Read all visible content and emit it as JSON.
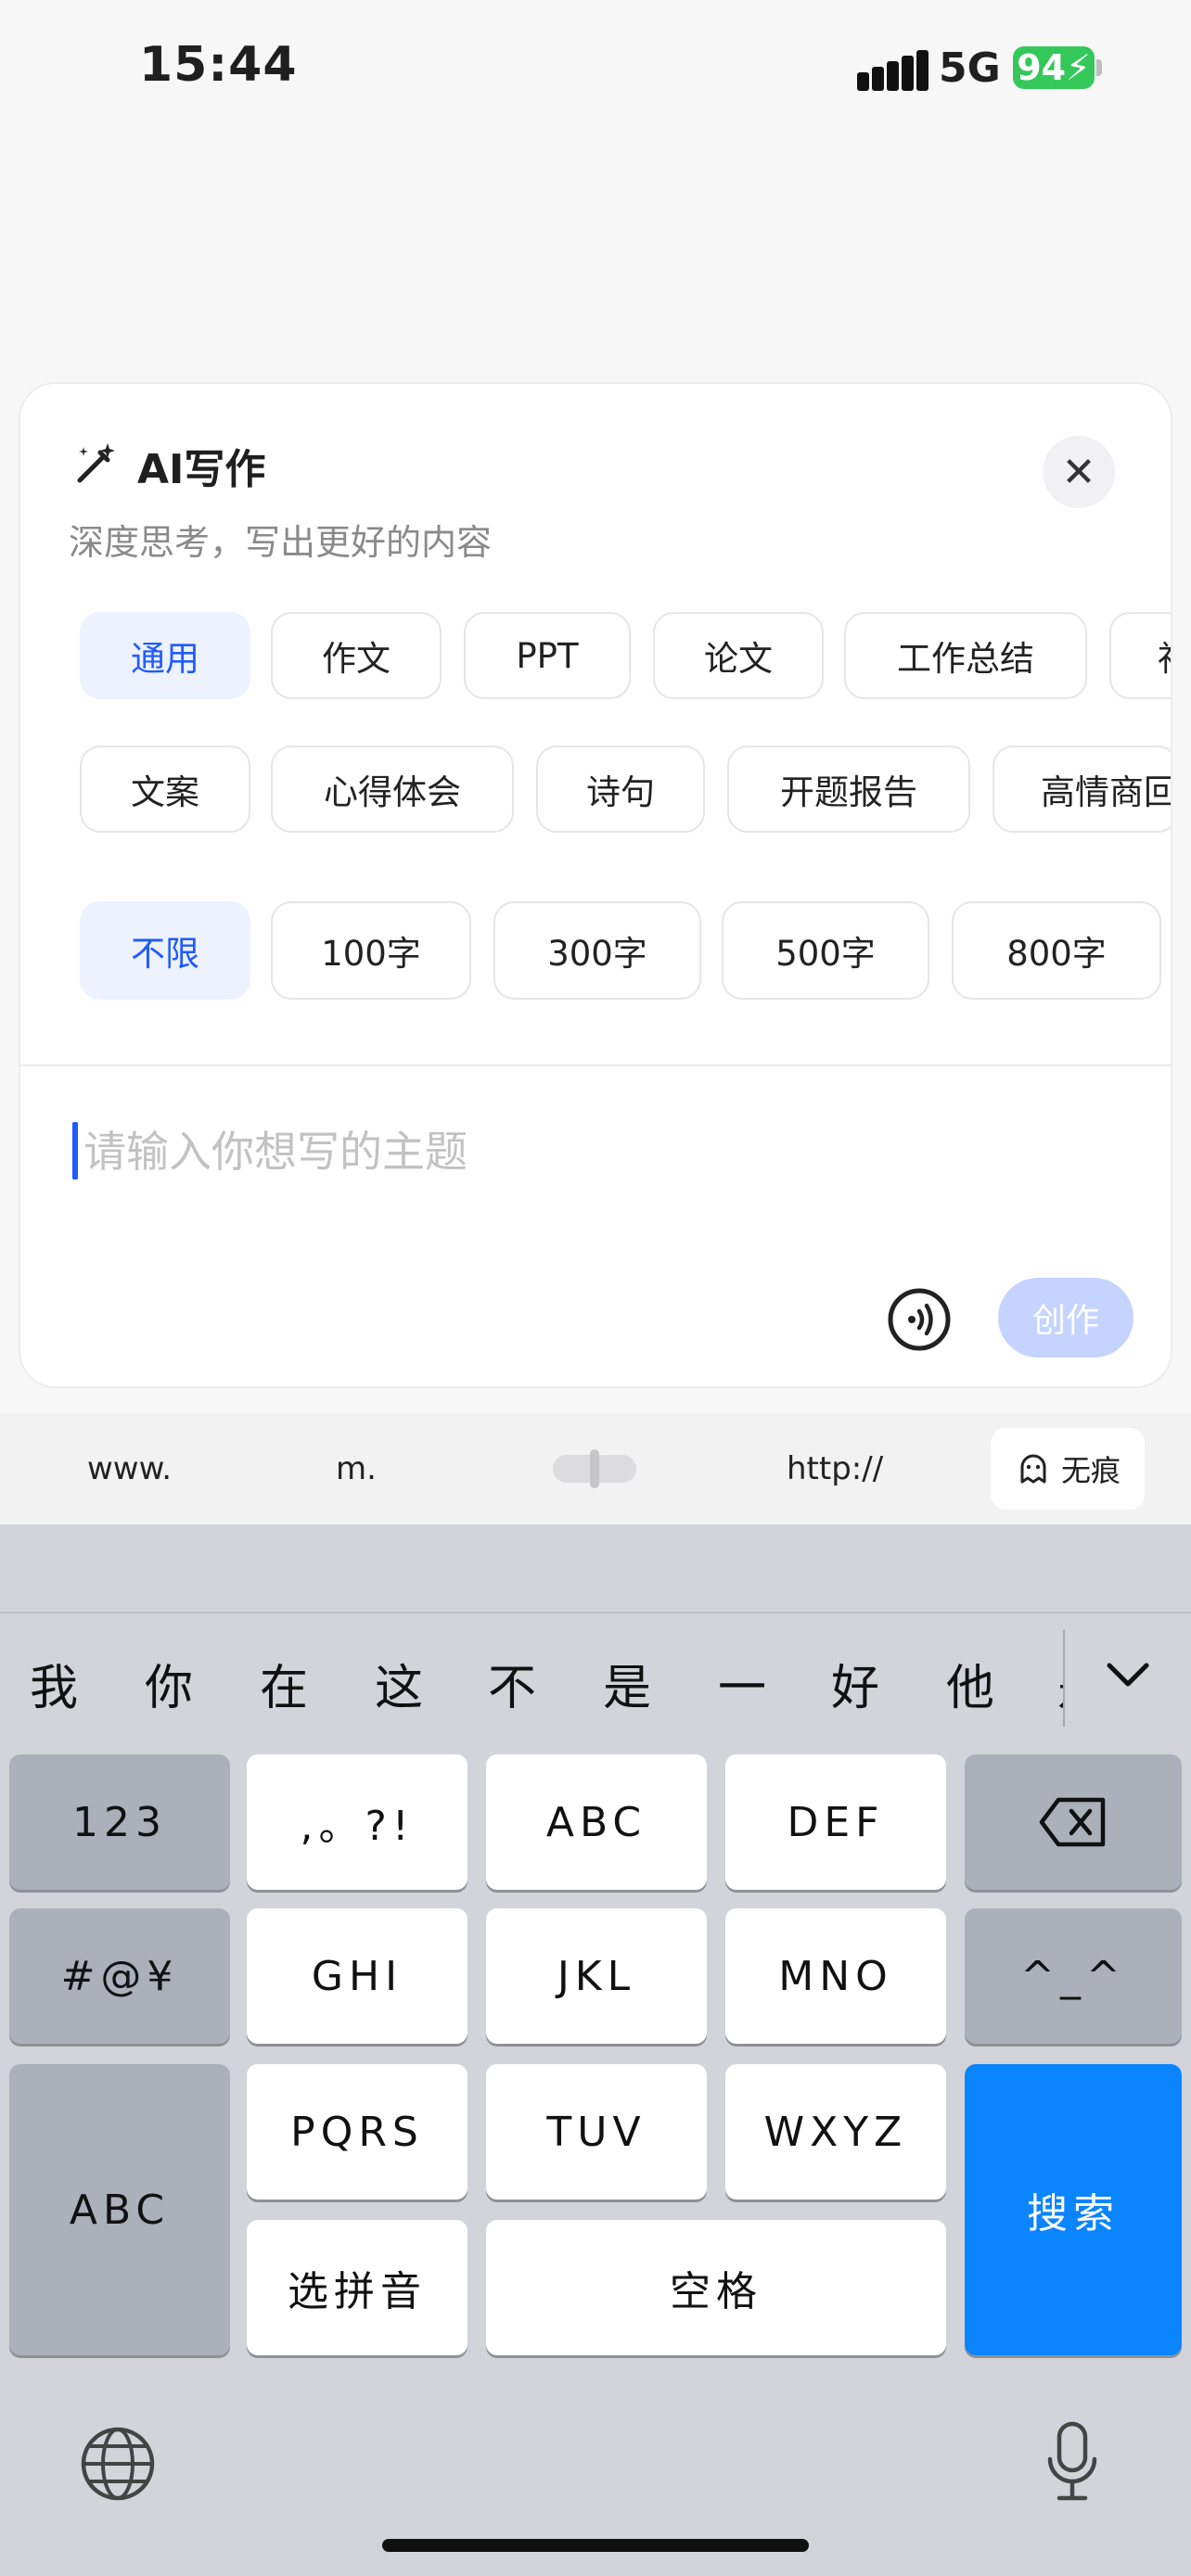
{
  "status_bar": {
    "time": "15:44",
    "network": "5G",
    "battery": "94"
  },
  "sheet": {
    "title": "AI写作",
    "subtitle": "深度思考，写出更好的内容",
    "close_label": "✕",
    "categories_row1": [
      "通用",
      "作文",
      "PPT",
      "论文",
      "工作总结",
      "社"
    ],
    "categories_row2": [
      "文案",
      "心得体会",
      "诗句",
      "开题报告",
      "高情商回"
    ],
    "lengths": [
      "不限",
      "100字",
      "300字",
      "500字",
      "800字"
    ],
    "topic_placeholder": "请输入你想写的主题",
    "create_label": "创作"
  },
  "url_bar": {
    "items": [
      "www.",
      "m.",
      "http://"
    ],
    "incognito_label": "无痕"
  },
  "keyboard": {
    "candidates": [
      "我",
      "你",
      "在",
      "这",
      "不",
      "是",
      "一",
      "好",
      "他",
      "是"
    ],
    "keys": {
      "num": "123",
      "punct": ",。?!",
      "abc": "ABC",
      "def": "DEF",
      "sym": "#@¥",
      "ghi": "GHI",
      "jkl": "JKL",
      "mno": "MNO",
      "emoji": "^_^",
      "abc_mode": "ABC",
      "pqrs": "PQRS",
      "tuv": "TUV",
      "wxyz": "WXYZ",
      "pinyin": "选拼音",
      "space": "空格",
      "search": "搜索"
    }
  },
  "colors": {
    "accent": "#1f5bff",
    "chip_active_bg": "#eef2ff",
    "create_disabled": "#c5d3ff",
    "search_key": "#0a84ff"
  }
}
